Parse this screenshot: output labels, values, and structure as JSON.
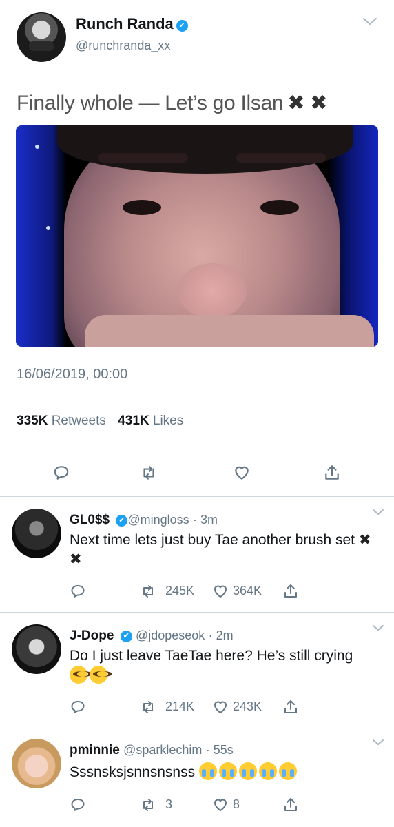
{
  "main_tweet": {
    "author_name": "Runch Randa",
    "verified_mark": "✔",
    "handle": "@runchranda_xx",
    "text": "Finally whole — Let’s go Ilsan",
    "text_emoji": "✖ ✖",
    "timestamp": "16/06/2019, 00:00",
    "retweets_count": "335K",
    "retweets_label": "Retweets",
    "likes_count": "431K",
    "likes_label": "Likes"
  },
  "replies": [
    {
      "name": "GL0$$",
      "verified_mark": "✔",
      "handle": "@mingloss",
      "time": "· 3m",
      "text": "Next time lets just buy Tae another brush set",
      "text_emoji": "✖ ✖",
      "retweets": "245K",
      "likes": "364K"
    },
    {
      "name": "J-Dope",
      "verified_mark": "✔",
      "handle": "@jdopeseok",
      "time": "· 2m",
      "text": "Do I just leave TaeTae here? He’s still crying",
      "retweets": "214K",
      "likes": "243K"
    },
    {
      "name": "pminnie",
      "handle": "@sparklechim",
      "time": "· 55s",
      "text": "Sssnsksjsnnsnsnss",
      "retweets": "3",
      "likes": "8"
    }
  ],
  "colors": {
    "verified_blue": "#1da1f2",
    "secondary_text": "#657786",
    "primary_text": "#14171a"
  },
  "icons": [
    "reply-icon",
    "retweet-icon",
    "like-icon",
    "share-icon",
    "chevron-down-icon"
  ]
}
